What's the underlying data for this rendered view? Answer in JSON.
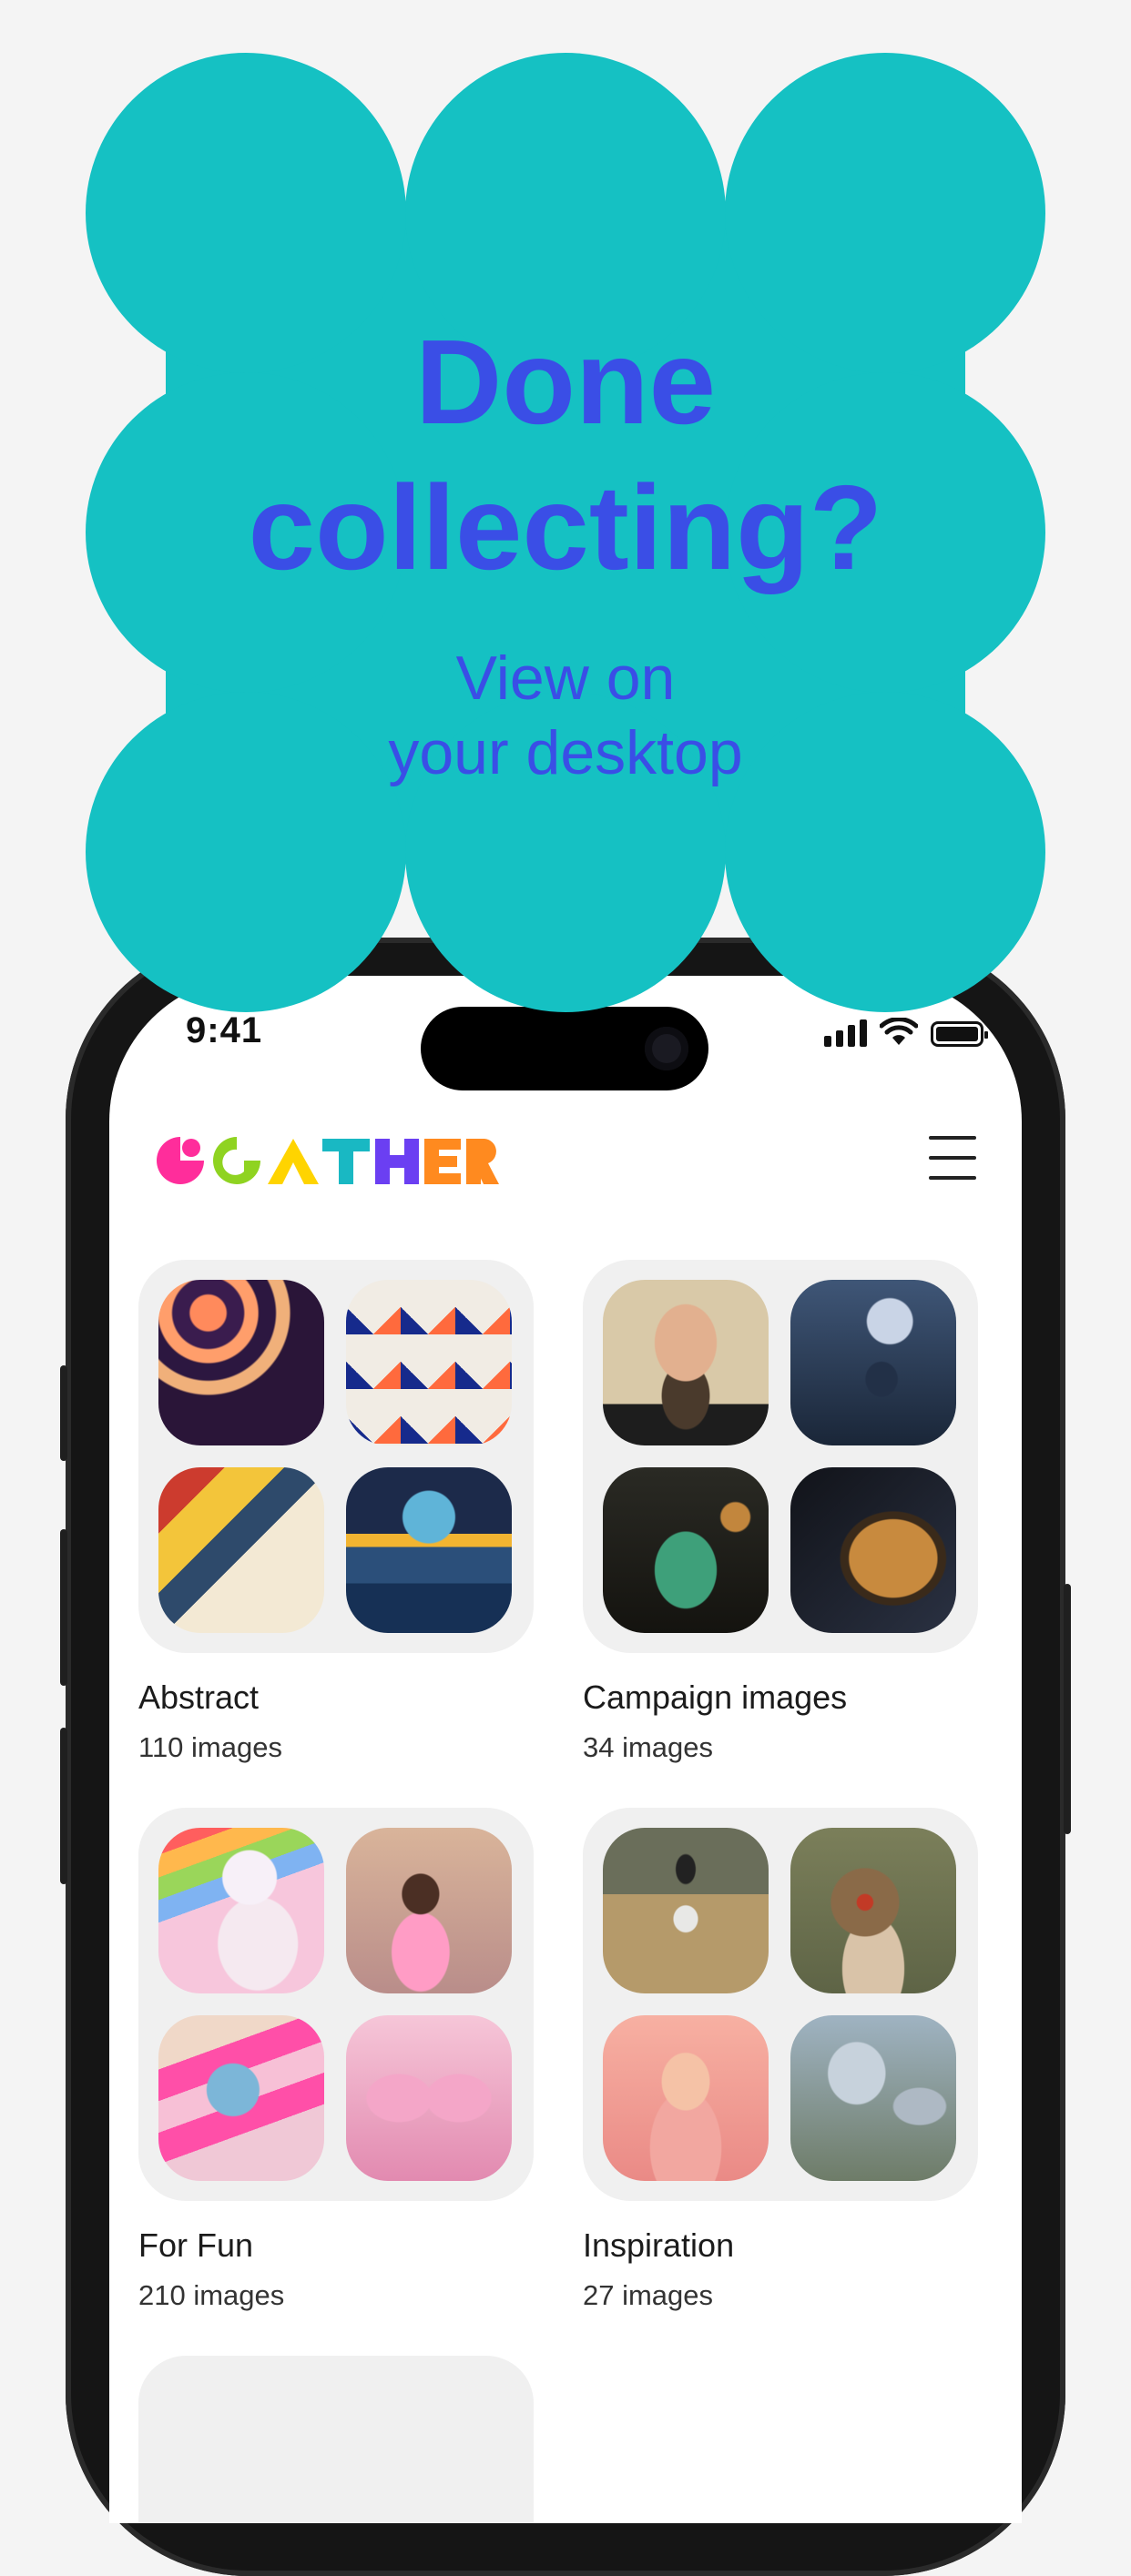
{
  "promo": {
    "title_line1": "Done",
    "title_line2": "collecting?",
    "subtitle_line1": "View on",
    "subtitle_line2": "your desktop",
    "accent_color": "#15c1c3",
    "text_color": "#3a4ee6"
  },
  "status_bar": {
    "time": "9:41",
    "icons": [
      "signal-icon",
      "wifi-icon",
      "battery-icon"
    ]
  },
  "header": {
    "logo_text": "GATHER",
    "logo_colors": [
      "#ff2d9b",
      "#8fd321",
      "#ffd400",
      "#19b8c3",
      "#6b3ff2",
      "#ff8a1f"
    ],
    "menu_icon": "hamburger-menu-icon"
  },
  "folders": [
    {
      "name": "Abstract",
      "count": "110 images"
    },
    {
      "name": "Campaign images",
      "count": "34 images"
    },
    {
      "name": "For Fun",
      "count": "210 images"
    },
    {
      "name": "Inspiration",
      "count": "27 images"
    }
  ]
}
